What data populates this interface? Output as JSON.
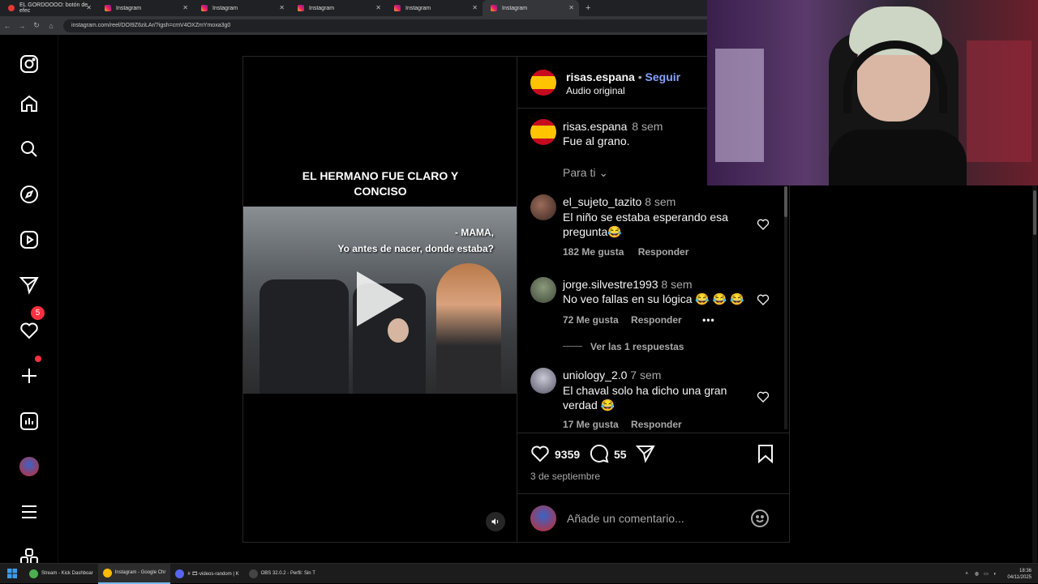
{
  "browser": {
    "tabs": [
      {
        "label": "EL GORDOOOO: botón de efec",
        "active": false
      },
      {
        "label": "Instagram",
        "active": false
      },
      {
        "label": "Instagram",
        "active": false
      },
      {
        "label": "Instagram",
        "active": false
      },
      {
        "label": "Instagram",
        "active": false
      },
      {
        "label": "Instagram",
        "active": true
      }
    ],
    "new_tab": "+",
    "url": "instagram.com/reel/DOI9Z6ziLAr/?igsh=cmV4OXZmYmoxa3g0"
  },
  "sidebar": {
    "notifications_badge": "5"
  },
  "post": {
    "caption_line1": "EL HERMANO FUE CLARO Y",
    "caption_line2": "CONCISO",
    "scene_line1": "- MAMA,",
    "scene_line2": "Yo antes de nacer, donde estaba?",
    "header": {
      "username": "risas.espana",
      "separator": "•",
      "follow": "Seguir",
      "audio": "Audio original"
    },
    "author_comment": {
      "username": "risas.espana",
      "time": "8 sem",
      "text": "Fue al grano."
    },
    "sort_label": "Para ti",
    "comments": [
      {
        "username": "el_sujeto_tazito",
        "time": "8 sem",
        "line1": "El niño se estaba esperando esa",
        "line2": "pregunta😂",
        "likes": "182 Me gusta",
        "reply": "Responder"
      },
      {
        "username": "jorge.silvestre1993",
        "time": "8 sem",
        "line1": "No veo fallas en su lógica 😂 😂 😂",
        "line2": "",
        "likes": "72 Me gusta",
        "reply": "Responder",
        "more": "•••",
        "view_replies": "Ver las 1 respuestas"
      },
      {
        "username": "uniology_2.0",
        "time": "7 sem",
        "line1": "El chaval solo ha dicho una gran",
        "line2": "verdad 😂",
        "likes": "17 Me gusta",
        "reply": "Responder"
      }
    ],
    "like_count": "9359",
    "comment_count": "55",
    "date": "3 de septiembre",
    "add_comment_placeholder": "Añade un comentario..."
  },
  "taskbar": {
    "items": [
      {
        "label": "Stream - Kick Dashboar",
        "color": "#4caf50",
        "active": false
      },
      {
        "label": "Instagram - Google Chr",
        "color": "#fbbc05",
        "active": true
      },
      {
        "label": "# 🎞-videos-random | K",
        "color": "#5865f2",
        "active": false
      },
      {
        "label": "OBS 32.0.2 - Perfil: Sin T",
        "color": "#444444",
        "active": false
      }
    ],
    "time": "18:36",
    "date": "04/11/2025"
  }
}
